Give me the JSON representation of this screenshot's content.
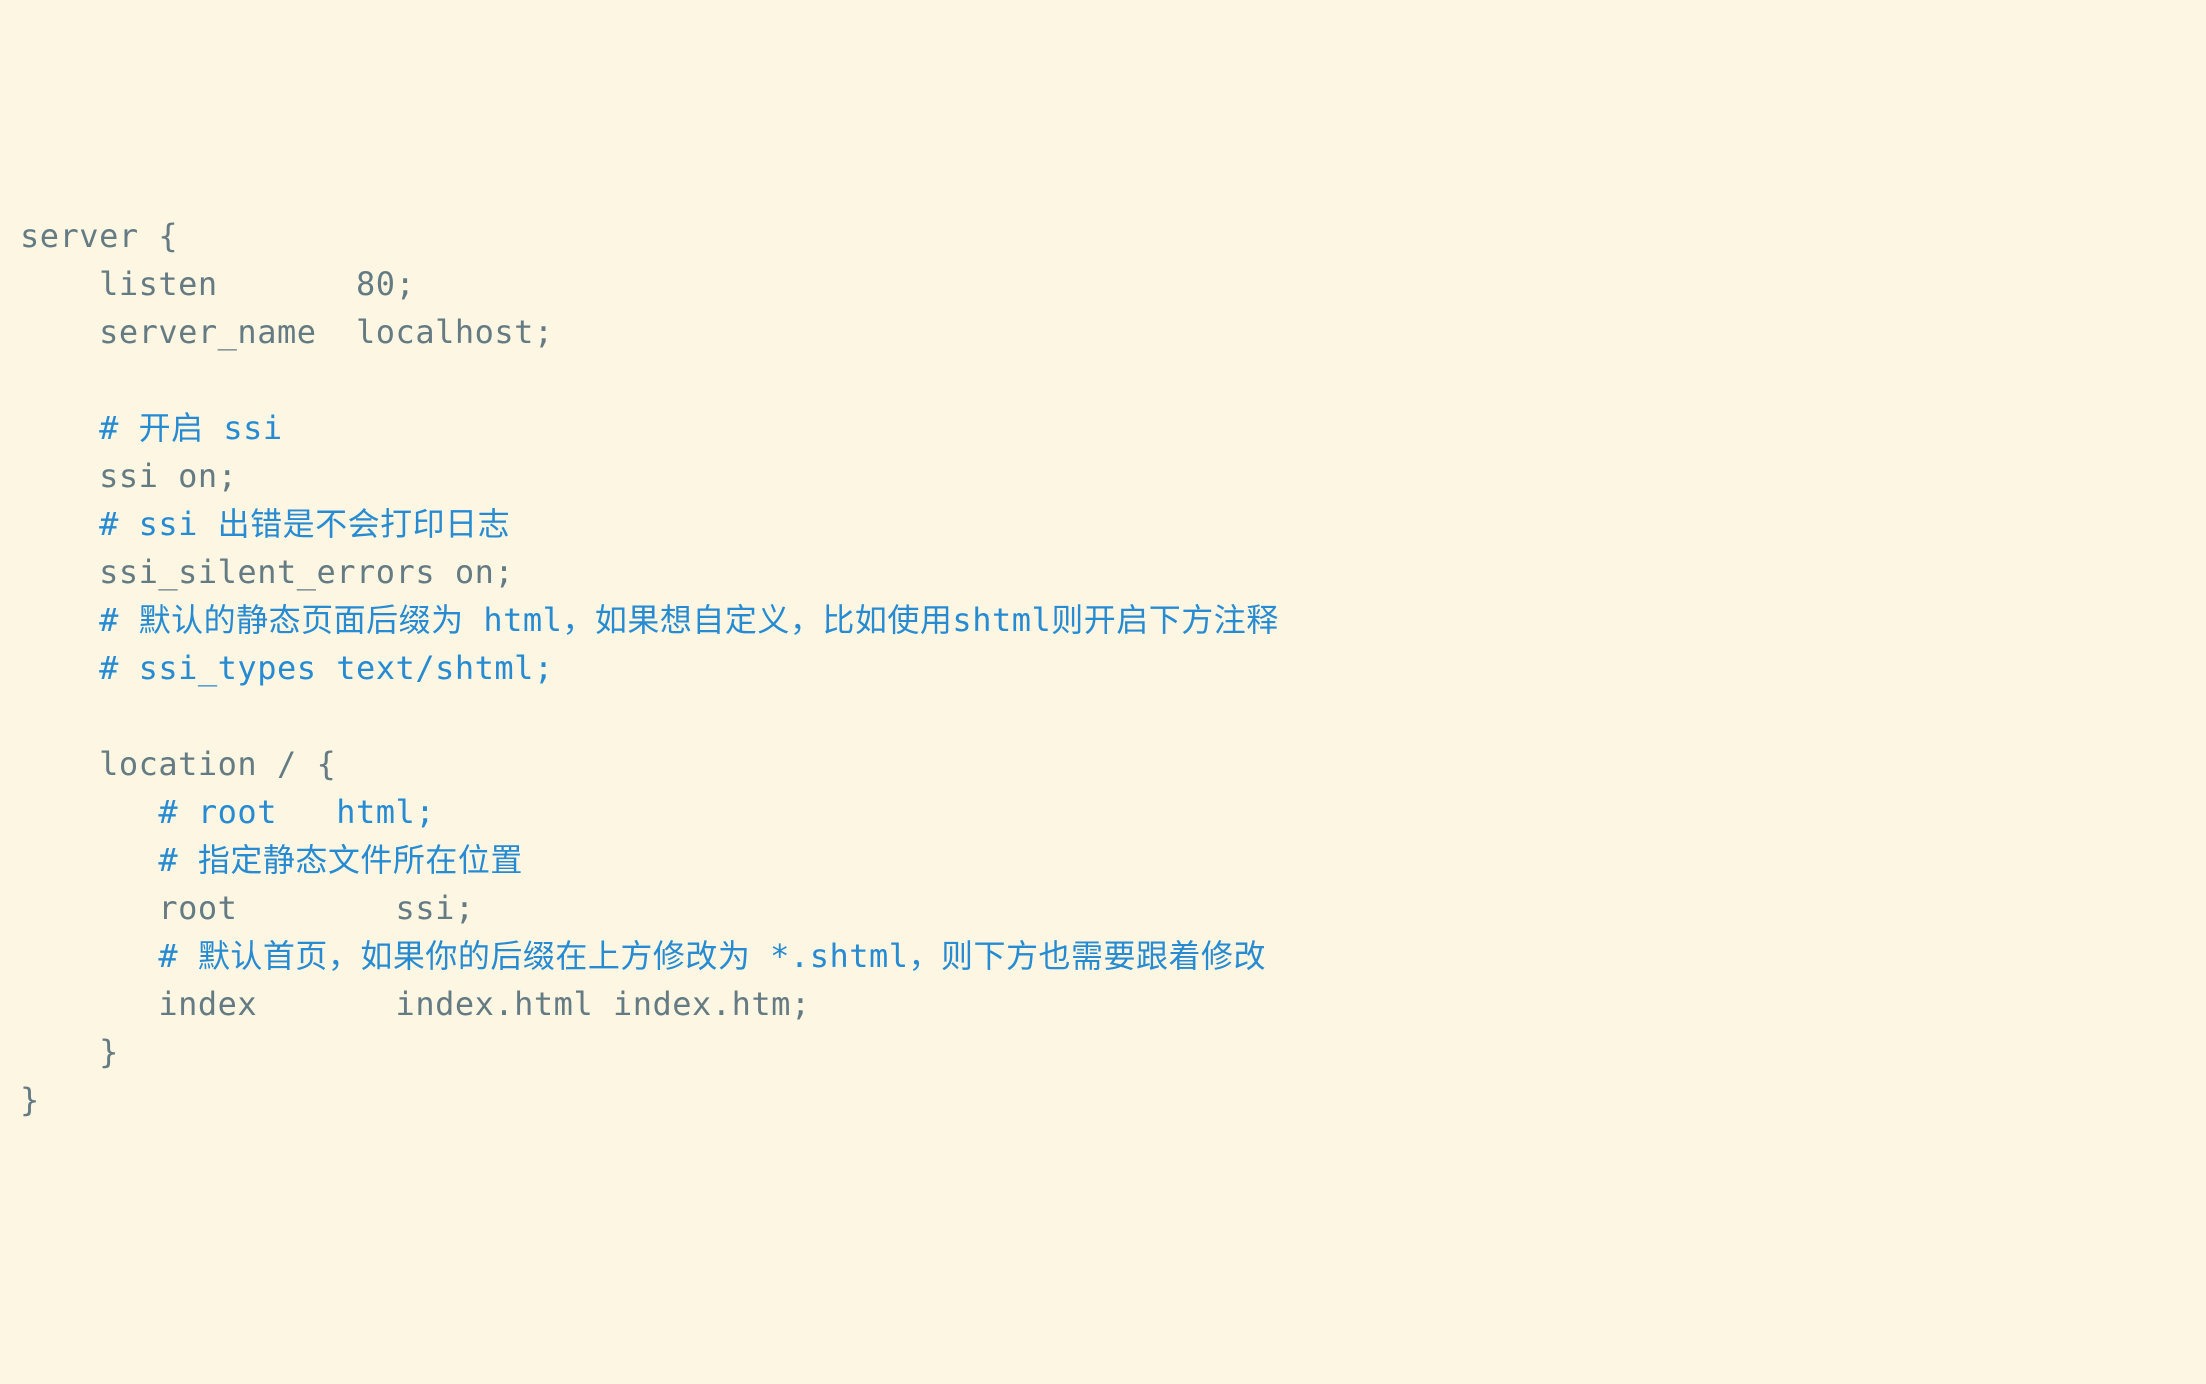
{
  "code": {
    "lines": [
      {
        "segments": [
          {
            "cls": "text",
            "t": "server {"
          }
        ]
      },
      {
        "segments": [
          {
            "cls": "text",
            "t": "    listen       80;"
          }
        ]
      },
      {
        "segments": [
          {
            "cls": "text",
            "t": "    server_name  localhost;"
          }
        ]
      },
      {
        "segments": [
          {
            "cls": "text",
            "t": ""
          }
        ]
      },
      {
        "segments": [
          {
            "cls": "text",
            "t": "    "
          },
          {
            "cls": "comment",
            "t": "# 开启 ssi"
          }
        ]
      },
      {
        "segments": [
          {
            "cls": "text",
            "t": "    ssi on;"
          }
        ]
      },
      {
        "segments": [
          {
            "cls": "text",
            "t": "    "
          },
          {
            "cls": "comment",
            "t": "# ssi 出错是不会打印日志"
          }
        ]
      },
      {
        "segments": [
          {
            "cls": "text",
            "t": "    ssi_silent_errors on;"
          }
        ]
      },
      {
        "segments": [
          {
            "cls": "text",
            "t": "    "
          },
          {
            "cls": "comment",
            "t": "# 默认的静态页面后缀为 html，如果想自定义，比如使用shtml则开启下方注释"
          }
        ]
      },
      {
        "segments": [
          {
            "cls": "text",
            "t": "    "
          },
          {
            "cls": "comment",
            "t": "# ssi_types text/shtml;"
          }
        ]
      },
      {
        "segments": [
          {
            "cls": "text",
            "t": ""
          }
        ]
      },
      {
        "segments": [
          {
            "cls": "text",
            "t": "    location / {"
          }
        ]
      },
      {
        "segments": [
          {
            "cls": "text",
            "t": "       "
          },
          {
            "cls": "comment",
            "t": "# root   html;"
          }
        ]
      },
      {
        "segments": [
          {
            "cls": "text",
            "t": "       "
          },
          {
            "cls": "comment",
            "t": "# 指定静态文件所在位置"
          }
        ]
      },
      {
        "segments": [
          {
            "cls": "text",
            "t": "       root        ssi;"
          }
        ]
      },
      {
        "segments": [
          {
            "cls": "text",
            "t": "       "
          },
          {
            "cls": "comment",
            "t": "# 默认首页，如果你的后缀在上方修改为 *.shtml，则下方也需要跟着修改"
          }
        ]
      },
      {
        "segments": [
          {
            "cls": "text",
            "t": "       index       index.html index.htm;"
          }
        ]
      },
      {
        "segments": [
          {
            "cls": "text",
            "t": "    }"
          }
        ]
      },
      {
        "segments": [
          {
            "cls": "text",
            "t": "}"
          }
        ]
      }
    ]
  }
}
